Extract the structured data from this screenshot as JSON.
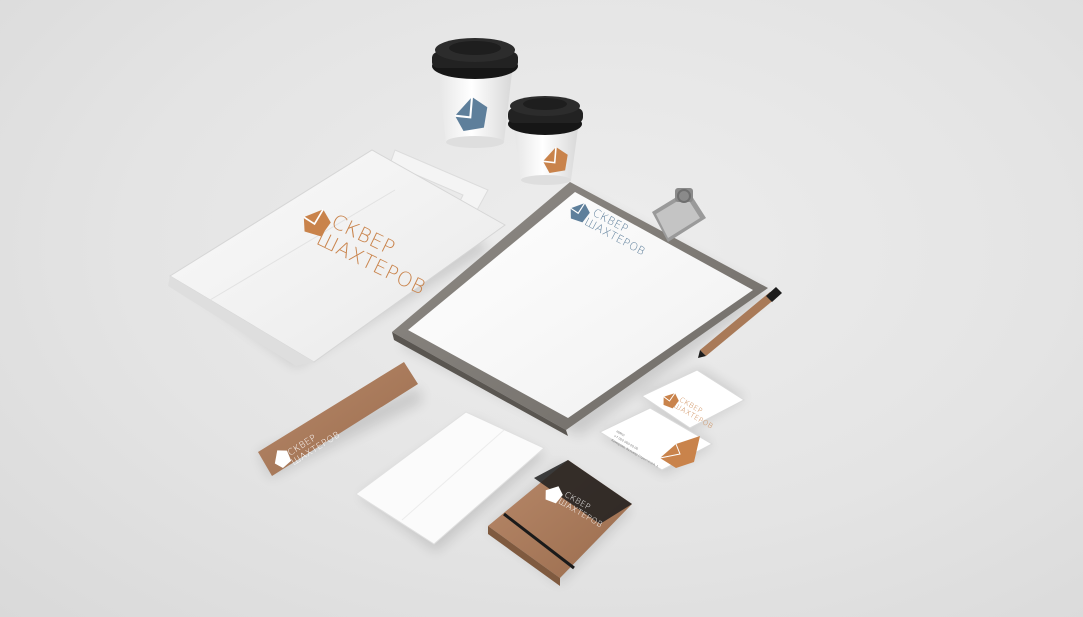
{
  "brand": {
    "line1": "СКВЕР",
    "line2": "ШАХТЕРОВ",
    "colors": {
      "orange": "#c9834b",
      "blue": "#5e7f9b",
      "kraft": "#a97a58",
      "cup_lid": "#1c1c1c",
      "background": "#e6e6e6"
    }
  },
  "card": {
    "contact_line1": "НИКО",
    "contact_line2": "+7 000 000-00-00",
    "contact_line3": "Кемерово, бульвар Строителей, 1"
  },
  "icons": {
    "logo": "crystal-logo-icon"
  }
}
